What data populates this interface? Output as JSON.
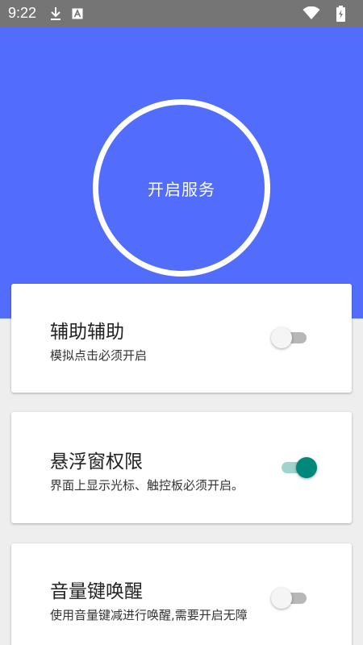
{
  "status_bar": {
    "time": "9:22",
    "icons": [
      "download-icon",
      "text-a-icon",
      "wifi-icon",
      "battery-charging-icon"
    ]
  },
  "hero": {
    "service_button_label": "开启服务",
    "background_color": "#526dfc"
  },
  "settings": [
    {
      "title": "辅助辅助",
      "description": "模拟点击必须开启",
      "enabled": false
    },
    {
      "title": "悬浮窗权限",
      "description": "界面上显示光标、触控板必须开启。",
      "enabled": true
    },
    {
      "title": "音量键唤醒",
      "description": "使用音量键减进行唤醒,需要开启无障",
      "enabled": false
    }
  ],
  "colors": {
    "accent": "#00897b",
    "accent_track": "#a1d3cc",
    "off_track": "#b7b7b7"
  }
}
